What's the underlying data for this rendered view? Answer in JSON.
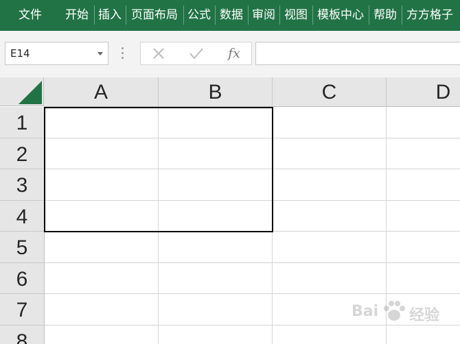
{
  "ribbon": {
    "background": "#217346",
    "tabs": [
      {
        "label": "文件"
      },
      {
        "label": "开始"
      },
      {
        "label": "插入"
      },
      {
        "label": "页面布局"
      },
      {
        "label": "公式"
      },
      {
        "label": "数据"
      },
      {
        "label": "审阅"
      },
      {
        "label": "视图"
      },
      {
        "label": "模板中心"
      },
      {
        "label": "帮助"
      },
      {
        "label": "方方格子"
      }
    ]
  },
  "formula_bar": {
    "name_box": "E14",
    "cancel_icon": "close-icon",
    "enter_icon": "check-icon",
    "function_label": "fx",
    "formula_value": ""
  },
  "sheet": {
    "columns": [
      "A",
      "B",
      "C",
      "D"
    ],
    "rows": [
      "1",
      "2",
      "3",
      "4",
      "5",
      "6",
      "7",
      "8"
    ],
    "bordered_range": "A1:B4"
  },
  "watermark": {
    "brand": "Bai",
    "suffix": "经验",
    "icon": "paw-icon"
  }
}
